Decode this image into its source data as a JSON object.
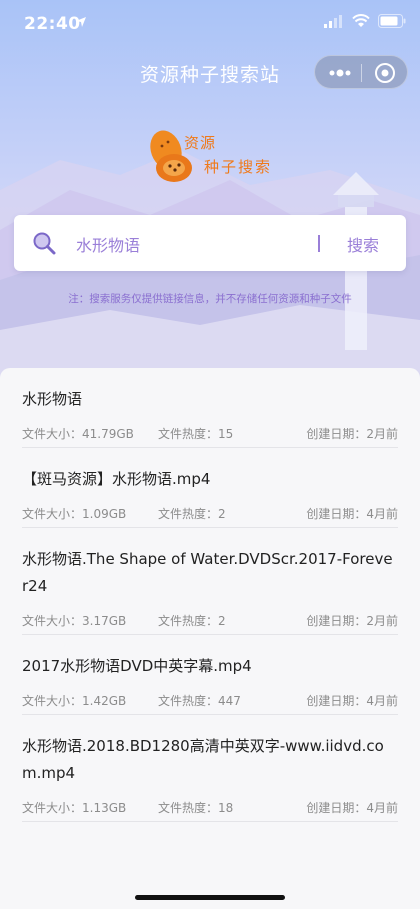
{
  "status": {
    "time": "22:40"
  },
  "nav": {
    "title": "资源种子搜索站"
  },
  "logo": {
    "line1": "资源",
    "line2": "种子搜索"
  },
  "search": {
    "query": "水形物语",
    "button_label": "搜索"
  },
  "notice": "注：搜索服务仅提供链接信息，并不存储任何资源和种子文件",
  "meta_labels": {
    "size": "文件大小：",
    "heat": "文件热度：",
    "date": "创建日期："
  },
  "results": [
    {
      "title": "水形物语",
      "size": "41.79GB",
      "heat": "15",
      "date": "2月前"
    },
    {
      "title": "【斑马资源】水形物语.mp4",
      "size": "1.09GB",
      "heat": "2",
      "date": "4月前"
    },
    {
      "title": "水形物语.The Shape of Water.DVDScr.2017-Forever24",
      "size": "3.17GB",
      "heat": "2",
      "date": "2月前"
    },
    {
      "title": "2017水形物语DVD中英字幕.mp4",
      "size": "1.42GB",
      "heat": "447",
      "date": "4月前"
    },
    {
      "title": "水形物语.2018.BD1280高清中英双字-www.iidvd.com.mp4",
      "size": "1.13GB",
      "heat": "18",
      "date": "4月前"
    }
  ],
  "colors": {
    "accent": "#9a7fd8",
    "logo": "#f07a1a"
  }
}
